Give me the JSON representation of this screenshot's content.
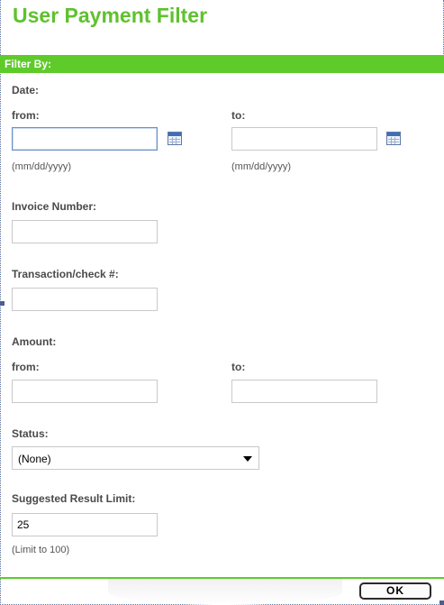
{
  "page": {
    "title": "User Payment Filter"
  },
  "filter_bar": {
    "label": "Filter By:"
  },
  "date": {
    "section_label": "Date:",
    "from_label": "from:",
    "to_label": "to:",
    "from_value": "",
    "to_value": "",
    "from_hint": "(mm/dd/yyyy)",
    "to_hint": "(mm/dd/yyyy)"
  },
  "invoice": {
    "label": "Invoice Number:",
    "value": ""
  },
  "transaction": {
    "label": "Transaction/check #:",
    "value": ""
  },
  "amount": {
    "section_label": "Amount:",
    "from_label": "from:",
    "to_label": "to:",
    "from_value": "",
    "to_value": ""
  },
  "status": {
    "label": "Status:",
    "selected": "(None)"
  },
  "result_limit": {
    "label": "Suggested Result Limit:",
    "value": "25",
    "hint": "(Limit to 100)"
  },
  "footer": {
    "ok_label": "OK"
  },
  "icons": {
    "calendar": "calendar-icon",
    "dropdown": "chevron-down-icon"
  },
  "colors": {
    "title_green": "#5ec22c",
    "bar_green": "#5ecb2b",
    "label_gray": "#4a4a4a"
  }
}
